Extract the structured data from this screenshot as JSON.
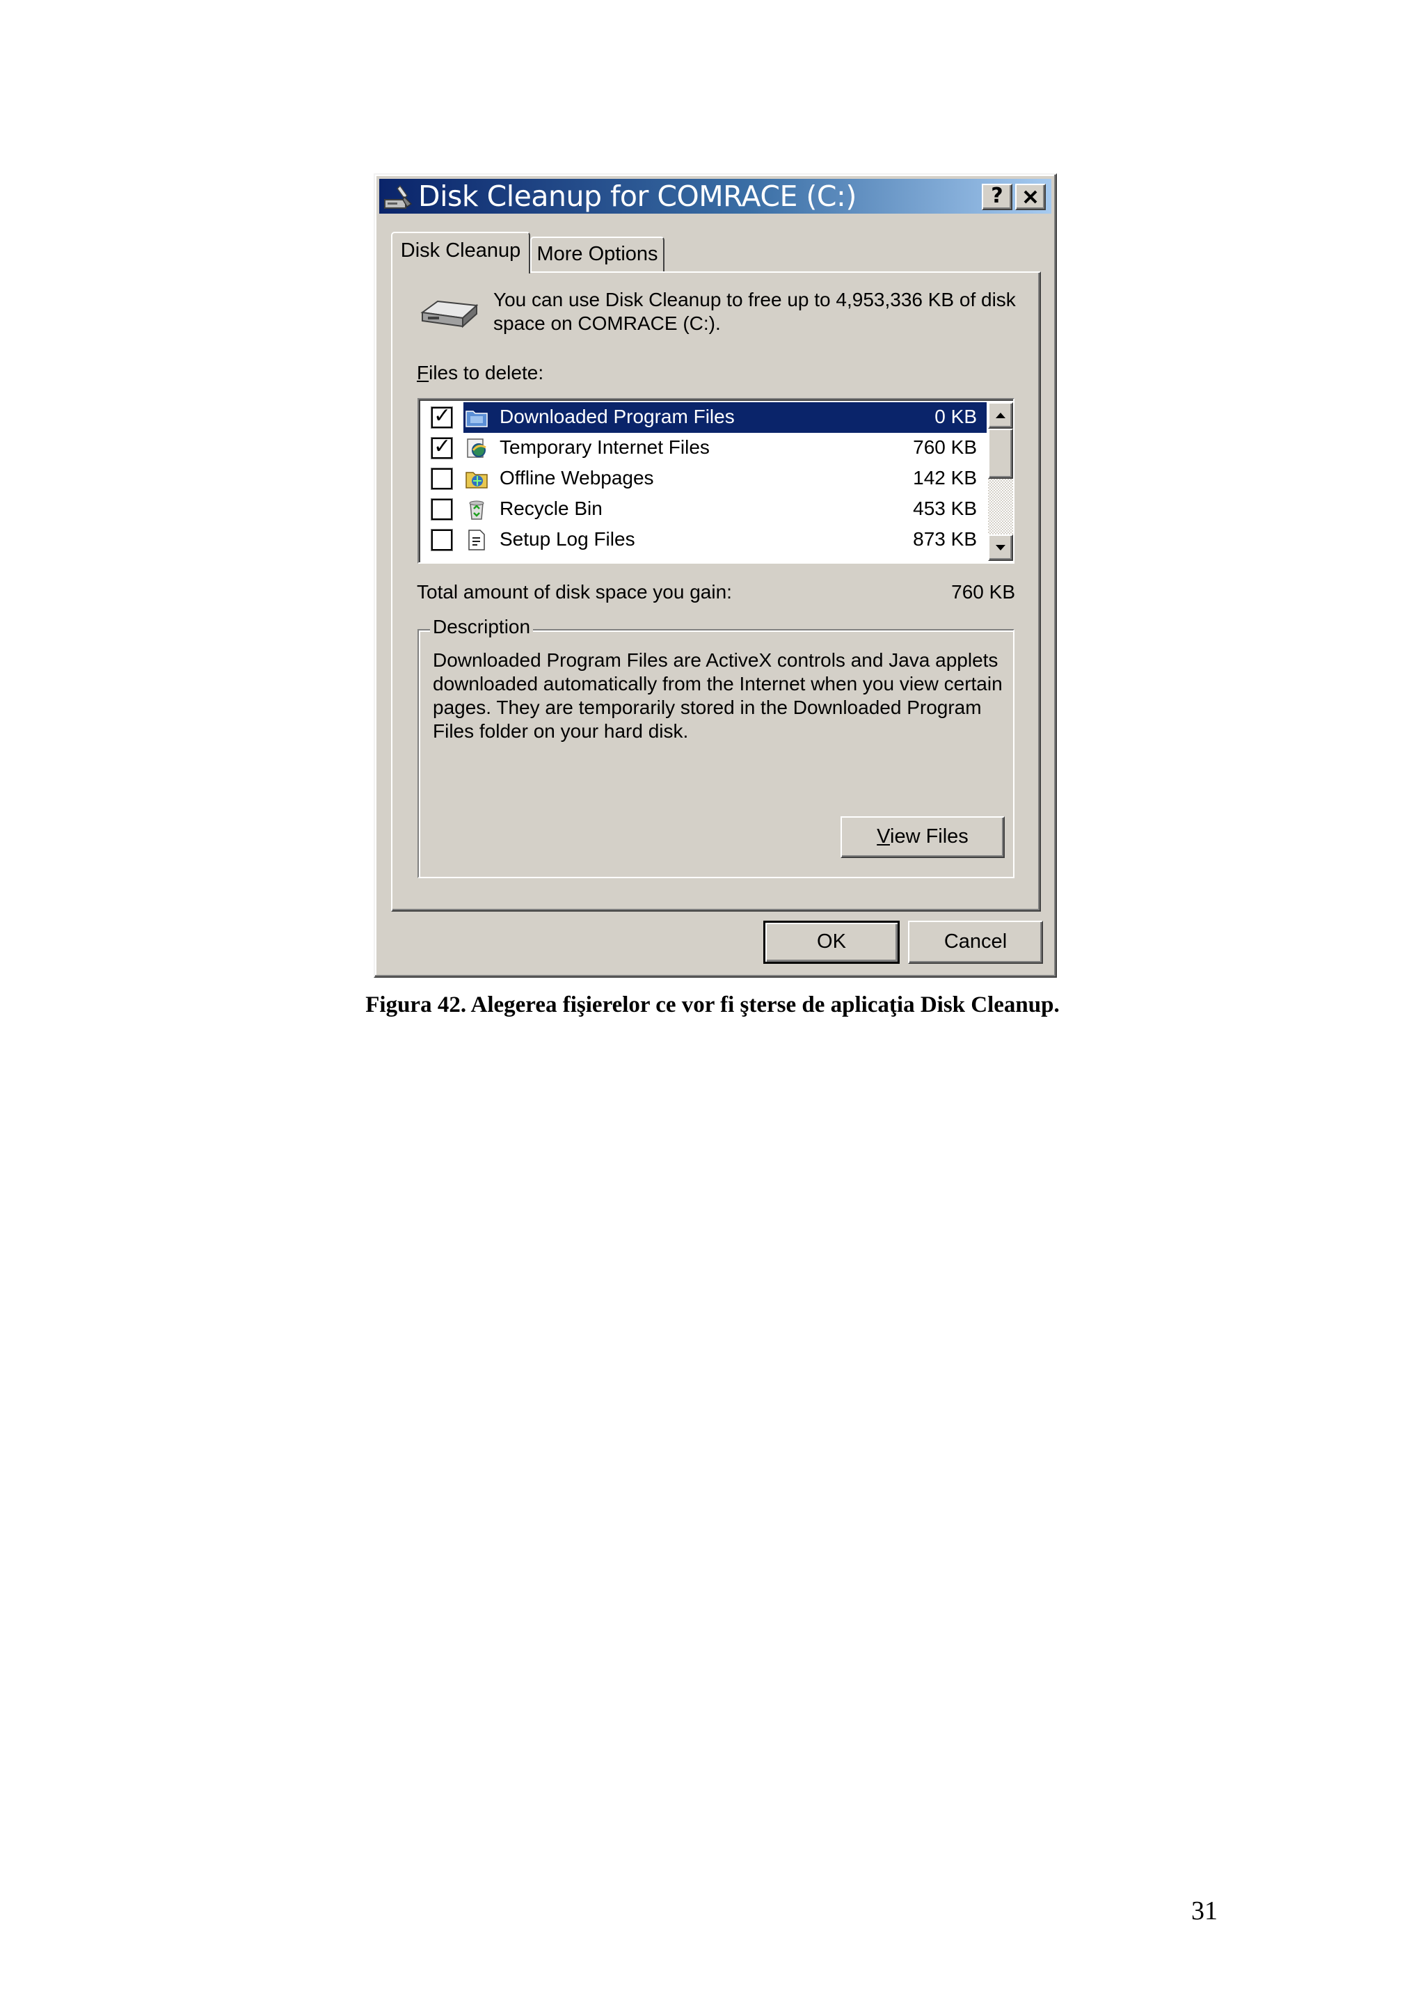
{
  "dialog": {
    "title": "Disk Cleanup for COMRACE (C:)",
    "help_label": "?",
    "close_label": "✕",
    "tabs": [
      {
        "label": "Disk Cleanup",
        "active": true
      },
      {
        "label": "More Options",
        "active": false
      }
    ],
    "intro_text": "You can use Disk Cleanup to free up to 4,953,336 KB of disk space on COMRACE (C:).",
    "files_label_underlined": "F",
    "files_label_rest": "iles to delete:",
    "files": [
      {
        "name": "Downloaded Program Files",
        "size": "0 KB",
        "checked": true,
        "selected": true,
        "icon": "folder-icon"
      },
      {
        "name": "Temporary Internet Files",
        "size": "760 KB",
        "checked": true,
        "selected": false,
        "icon": "internet-files-icon"
      },
      {
        "name": "Offline Webpages",
        "size": "142 KB",
        "checked": false,
        "selected": false,
        "icon": "offline-webpages-icon"
      },
      {
        "name": "Recycle Bin",
        "size": "453 KB",
        "checked": false,
        "selected": false,
        "icon": "recycle-bin-icon"
      },
      {
        "name": "Setup Log Files",
        "size": "873 KB",
        "checked": false,
        "selected": false,
        "icon": "log-file-icon"
      }
    ],
    "total_label": "Total amount of disk space you gain:",
    "total_value": "760 KB",
    "description_legend": "Description",
    "description_text": "Downloaded Program Files are ActiveX controls and Java applets downloaded automatically from the Internet when you view certain pages. They are temporarily stored in the Downloaded Program Files folder on your hard disk.",
    "view_files_underlined": "V",
    "view_files_rest": "iew Files",
    "ok_label": "OK",
    "cancel_label": "Cancel",
    "colors": {
      "face": "#d4d0c8",
      "title_start": "#0a246a",
      "title_end": "#a6caf0",
      "selection": "#0a246a"
    }
  },
  "caption": "Figura 42. Alegerea fişierelor ce vor fi şterse de aplicaţia Disk Cleanup.",
  "page_number": "31"
}
